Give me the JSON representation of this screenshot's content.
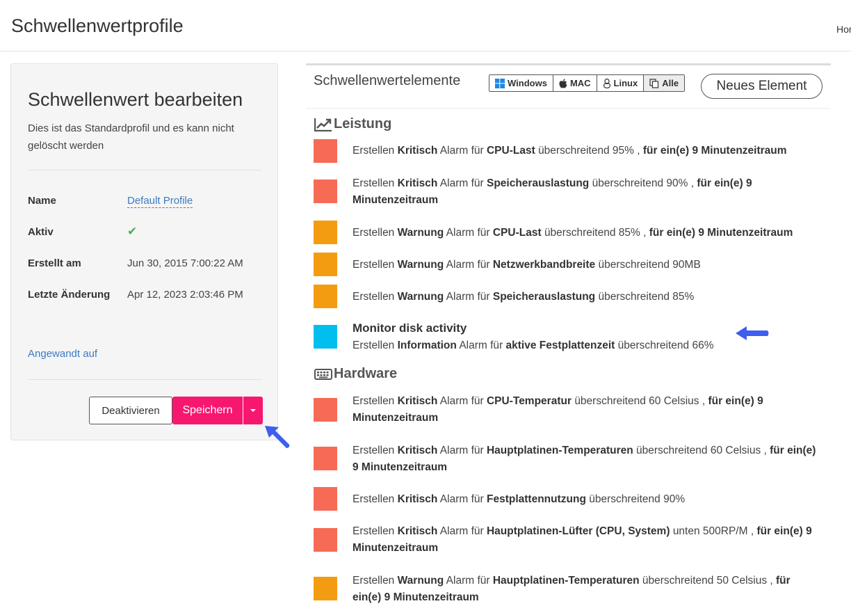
{
  "header": {
    "title": "Schwellenwertprofile",
    "breadcrumb": "Hom"
  },
  "editor": {
    "title": "Schwellenwert bearbeiten",
    "description": "Dies ist das Standardprofil und es kann nicht gelöscht werden",
    "fields": {
      "name_label": "Name",
      "name_value": "Default Profile",
      "active_label": "Aktiv",
      "created_label": "Erstellt am",
      "created_value": "Jun 30, 2015 7:00:22 AM",
      "modified_label": "Letzte Änderung",
      "modified_value": "Apr 12, 2023 2:03:46 PM"
    },
    "applied_link": "Angewandt auf",
    "deactivate_label": "Deaktivieren",
    "save_label": "Speichern"
  },
  "elements": {
    "title": "Schwellenwertelemente",
    "os_filters": [
      {
        "label": "Windows",
        "icon": "windows-icon"
      },
      {
        "label": "MAC",
        "icon": "apple-icon"
      },
      {
        "label": "Linux",
        "icon": "linux-icon"
      },
      {
        "label": "Alle",
        "icon": "copy-icon"
      }
    ],
    "new_label": "Neues Element",
    "severity_colors": {
      "Kritisch": "#f76a56",
      "Warnung": "#f39c12",
      "Information": "#00bfee"
    },
    "sections": [
      {
        "title": "Leistung",
        "icon": "line-chart-icon",
        "items": [
          {
            "severity": "Kritisch",
            "metric": "CPU-Last",
            "threshold": "überschreitend 95% ,",
            "period": "für ein(e) 9 Minutenzeitraum"
          },
          {
            "severity": "Kritisch",
            "metric": "Speicherauslastung",
            "threshold": "überschreitend 90% ,",
            "period": "für ein(e) 9 Minutenzeitraum"
          },
          {
            "severity": "Warnung",
            "metric": "CPU-Last",
            "threshold": "überschreitend 85% ,",
            "period": "für ein(e) 9 Minutenzeitraum"
          },
          {
            "severity": "Warnung",
            "metric": "Netzwerkbandbreite",
            "threshold": "überschreitend 90MB",
            "period": ""
          },
          {
            "severity": "Warnung",
            "metric": "Speicherauslastung",
            "threshold": "überschreitend 85%",
            "period": ""
          },
          {
            "heading": "Monitor disk activity",
            "severity": "Information",
            "metric": "aktive Festplattenzeit",
            "threshold": "überschreitend 66%",
            "period": ""
          }
        ]
      },
      {
        "title": "Hardware",
        "icon": "keyboard-icon",
        "items": [
          {
            "severity": "Kritisch",
            "metric": "CPU-Temperatur",
            "threshold": "überschreitend 60 Celsius ,",
            "period": "für ein(e) 9 Minutenzeitraum"
          },
          {
            "severity": "Kritisch",
            "metric": "Hauptplatinen-Temperaturen",
            "threshold": "überschreitend 60 Celsius ,",
            "period": "für ein(e) 9 Minutenzeitraum"
          },
          {
            "severity": "Kritisch",
            "metric": "Festplattennutzung",
            "threshold": "überschreitend 90%",
            "period": ""
          },
          {
            "severity": "Kritisch",
            "metric": "Hauptplatinen-Lüfter (CPU, System)",
            "threshold": "unten 500RP/M ,",
            "period": "für ein(e) 9 Minutenzeitraum"
          },
          {
            "severity": "Warnung",
            "metric": "Hauptplatinen-Temperaturen",
            "threshold": "überschreitend 50 Celsius ,",
            "period": "für ein(e) 9 Minutenzeitraum"
          }
        ]
      }
    ],
    "word_create": "Erstellen",
    "word_alarm": "Alarm für"
  }
}
